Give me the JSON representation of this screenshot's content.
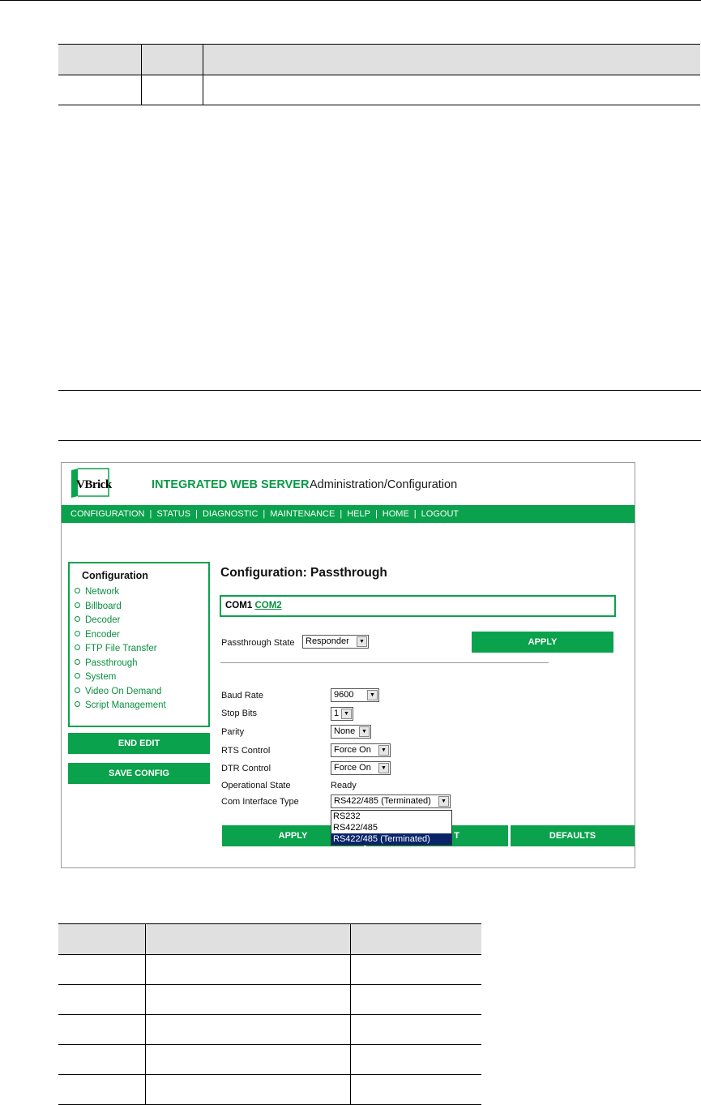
{
  "app": {
    "logo_text": "VBrick",
    "title": "INTEGRATED WEB SERVER",
    "subtitle": "Administration/Configuration"
  },
  "nav": [
    "CONFIGURATION",
    "STATUS",
    "DIAGNOSTIC",
    "MAINTENANCE",
    "HELP",
    "HOME",
    "LOGOUT"
  ],
  "sidebar": {
    "title": "Configuration",
    "items": [
      "Network",
      "Billboard",
      "Decoder",
      "Encoder",
      "FTP File Transfer",
      "Passthrough",
      "System",
      "Video On Demand",
      "Script Management"
    ],
    "end_edit": "END EDIT",
    "save_config": "SAVE CONFIG"
  },
  "main": {
    "heading": "Configuration: Passthrough",
    "com1": "COM1",
    "com2": "COM2",
    "passthrough_state_label": "Passthrough State",
    "passthrough_state_value": "Responder",
    "apply_top": "APPLY",
    "fields": {
      "baud_rate_label": "Baud Rate",
      "baud_rate_value": "9600",
      "stop_bits_label": "Stop Bits",
      "stop_bits_value": "1",
      "parity_label": "Parity",
      "parity_value": "None",
      "rts_label": "RTS Control",
      "rts_value": "Force On",
      "dtr_label": "DTR Control",
      "dtr_value": "Force On",
      "op_state_label": "Operational State",
      "op_state_value": "Ready",
      "com_type_label": "Com Interface Type",
      "com_type_value": "RS422/485 (Terminated)"
    },
    "com_type_options": [
      "RS232",
      "RS422/485",
      "RS422/485 (Terminated)"
    ],
    "apply_bottom": "APPLY",
    "reset_fragment": "T",
    "defaults": "DEFAULTS"
  }
}
